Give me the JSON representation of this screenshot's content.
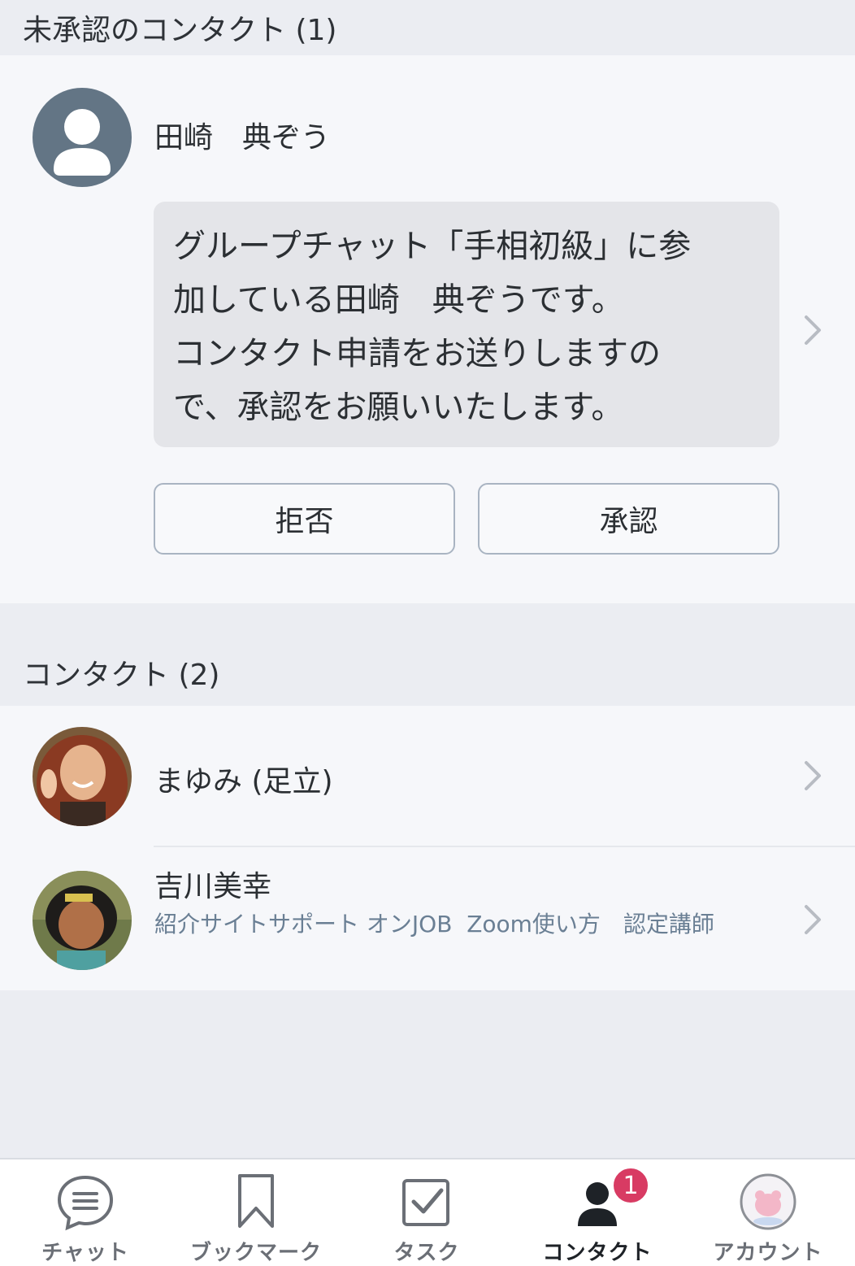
{
  "pending_section": {
    "title": "未承認のコンタクト (1)",
    "request": {
      "name": "田崎　典ぞう",
      "message": "グループチャット「手相初級」に参\n加している田崎　典ぞうです。\nコンタクト申請をお送りしますの\nで、承認をお願いいたします。",
      "reject_label": "拒否",
      "approve_label": "承認"
    }
  },
  "contacts_section": {
    "title": "コンタクト (2)",
    "contacts": [
      {
        "name": "まゆみ (足立)",
        "subtitle": ""
      },
      {
        "name": "吉川美幸",
        "subtitle": "紹介サイトサポート オンJOB  Zoom使い方　認定講師"
      }
    ]
  },
  "tabbar": {
    "tabs": [
      {
        "label": "チャット",
        "icon": "chat-icon"
      },
      {
        "label": "ブックマーク",
        "icon": "bookmark-icon"
      },
      {
        "label": "タスク",
        "icon": "task-icon"
      },
      {
        "label": "コンタクト",
        "icon": "contact-icon",
        "active": true,
        "badge": "1"
      },
      {
        "label": "アカウント",
        "icon": "account-avatar-icon"
      }
    ]
  },
  "colors": {
    "background": "#ebedf2",
    "panel": "#f6f7fa",
    "badge": "#d83b63",
    "subtitle": "#6a7f94"
  }
}
